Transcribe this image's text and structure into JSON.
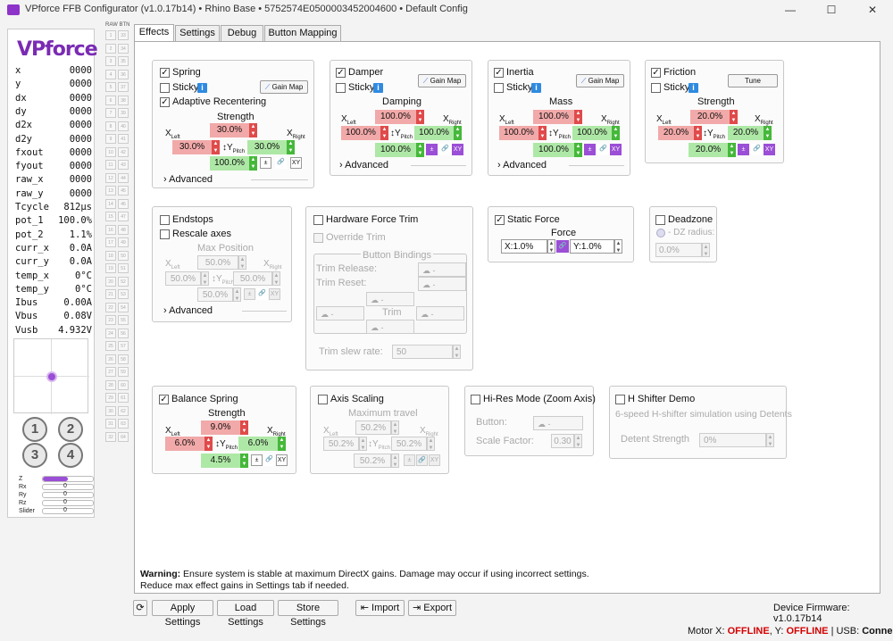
{
  "window": {
    "title": "VPforce FFB Configurator (v1.0.17b14) • Rhino Base • 5752574E0500003452004600 • Default Config",
    "minimize": "—",
    "maximize": "☐",
    "close": "✕"
  },
  "left": {
    "logo": "VPforce",
    "axes": [
      {
        "k": "x",
        "v": "0000"
      },
      {
        "k": "y",
        "v": "0000"
      },
      {
        "k": "dx",
        "v": "0000"
      },
      {
        "k": "dy",
        "v": "0000"
      },
      {
        "k": "d2x",
        "v": "0000"
      },
      {
        "k": "d2y",
        "v": "0000"
      },
      {
        "k": "fxout",
        "v": "0000"
      },
      {
        "k": "fyout",
        "v": "0000"
      },
      {
        "k": "raw_x",
        "v": "0000"
      },
      {
        "k": "raw_y",
        "v": "0000"
      },
      {
        "k": "Tcycle",
        "v": "812µs"
      },
      {
        "k": "pot_1",
        "v": "100.0%"
      },
      {
        "k": "pot_2",
        "v": "1.1%"
      },
      {
        "k": "curr_x",
        "v": "0.0A"
      },
      {
        "k": "curr_y",
        "v": "0.0A"
      },
      {
        "k": "temp_x",
        "v": "0°C"
      },
      {
        "k": "temp_y",
        "v": "0°C"
      },
      {
        "k": "Ibus",
        "v": "0.00A"
      },
      {
        "k": "Vbus",
        "v": "0.08V"
      },
      {
        "k": "Vusb",
        "v": "4.932V"
      }
    ],
    "buttons": [
      "1",
      "2",
      "3",
      "4"
    ],
    "bar_axes": [
      {
        "label": "Z",
        "value": "",
        "fill": 0.5
      },
      {
        "label": "Rx",
        "value": "0",
        "fill": 0
      },
      {
        "label": "Ry",
        "value": "0",
        "fill": 0
      },
      {
        "label": "Rz",
        "value": "0",
        "fill": 0
      },
      {
        "label": "Slider",
        "value": "0",
        "fill": 0
      }
    ],
    "accent": "#9b4ed6"
  },
  "rawbtn": {
    "title": "RAW BTN",
    "col1": [
      "1",
      "2",
      "3",
      "4",
      "5",
      "6",
      "7",
      "8",
      "9",
      "10",
      "11",
      "12",
      "13",
      "14",
      "15",
      "16",
      "17",
      "18",
      "19",
      "20",
      "21",
      "22",
      "23",
      "24",
      "25",
      "26",
      "27",
      "28",
      "29",
      "30",
      "31",
      "32"
    ],
    "col2": [
      "33",
      "34",
      "35",
      "36",
      "37",
      "38",
      "39",
      "40",
      "41",
      "42",
      "43",
      "44",
      "45",
      "46",
      "47",
      "48",
      "49",
      "50",
      "51",
      "52",
      "53",
      "54",
      "55",
      "56",
      "57",
      "58",
      "59",
      "60",
      "61",
      "62",
      "63",
      "64"
    ]
  },
  "tabs": [
    "Effects",
    "Settings",
    "Debug",
    "Button Mapping"
  ],
  "spring": {
    "title": "Spring",
    "sticky": "Sticky",
    "gainmap": "Gain Map",
    "adaptive": "Adaptive Recentering",
    "strength": "Strength",
    "center": "30.0%",
    "xleft": "30.0%",
    "ypitch": "30.0%",
    "bottom": "100.0%",
    "xleft_lbl": "X",
    "xleft_sub": "Left",
    "xright_lbl": "X",
    "xright_sub": "Right",
    "ypitch_lbl": "↕Y",
    "ypitch_sub": "Pitch",
    "advanced": "Advanced",
    "pm": "±",
    "link": "🔗",
    "xy": "XY"
  },
  "damper": {
    "title": "Damper",
    "sticky": "Sticky",
    "gainmap": "Gain Map",
    "label": "Damping",
    "center": "100.0%",
    "xleft": "100.0%",
    "ypitch": "100.0%",
    "bottom": "100.0%",
    "advanced": "Advanced"
  },
  "inertia": {
    "title": "Inertia",
    "sticky": "Sticky",
    "gainmap": "Gain Map",
    "label": "Mass",
    "center": "100.0%",
    "xleft": "100.0%",
    "ypitch": "100.0%",
    "bottom": "100.0%",
    "advanced": "Advanced"
  },
  "friction": {
    "title": "Friction",
    "sticky": "Sticky",
    "tune": "Tune",
    "label": "Strength",
    "center": "20.0%",
    "xleft": "20.0%",
    "ypitch": "20.0%",
    "bottom": "20.0%"
  },
  "endstops": {
    "title": "Endstops",
    "rescale": "Rescale axes",
    "maxpos": "Max Position",
    "center": "50.0%",
    "xleft": "50.0%",
    "ypitch": "50.0%",
    "bottom": "50.0%",
    "advanced": "Advanced"
  },
  "hwtrim": {
    "title": "Hardware Force Trim",
    "override": "Override Trim",
    "bindings": "Button Bindings",
    "release": "Trim Release:",
    "reset": "Trim Reset:",
    "dash": "-",
    "trim": "Trim",
    "slew": "Trim slew rate:",
    "slew_value": "50"
  },
  "static": {
    "title": "Static Force",
    "force": "Force",
    "x": "X:1.0%",
    "y": "Y:1.0%"
  },
  "deadzone": {
    "title": "Deadzone",
    "radius": "- DZ radius:",
    "value": "0.0%"
  },
  "balance": {
    "title": "Balance Spring",
    "label": "Strength",
    "center": "9.0%",
    "xleft": "6.0%",
    "ypitch": "6.0%",
    "bottom": "4.5%"
  },
  "axisscaling": {
    "title": "Axis Scaling",
    "label": "Maximum travel",
    "center": "50.2%",
    "xleft": "50.2%",
    "ypitch": "50.2%",
    "bottom": "50.2%"
  },
  "hires": {
    "title": "Hi-Res Mode (Zoom Axis)",
    "button": "Button:",
    "factor": "Scale Factor:",
    "dash": "-",
    "factor_value": "0.30"
  },
  "hshifter": {
    "title": "H Shifter Demo",
    "desc": "6-speed H-shifter simulation using Detents",
    "detent": "Detent Strength",
    "detent_value": "0%"
  },
  "warning": {
    "bold": "Warning:",
    "line1": " Ensure system is stable at maximum DirectX gains. Damage may occur if using incorrect settings.",
    "line2": "Reduce max effect gains in Settings tab if needed."
  },
  "bottom": {
    "refresh": "⟳",
    "apply": "Apply Settings",
    "load": "Load Settings",
    "store": "Store Settings",
    "import": "Import",
    "export": "Export",
    "firmware": "Device Firmware:  v1.0.17b14"
  },
  "status": {
    "motorx": "Motor X: ",
    "offline": "OFFLINE",
    "y": ", Y: ",
    "usb": " | USB: ",
    "connected": "Connected",
    "offline_color": "#d40000"
  }
}
